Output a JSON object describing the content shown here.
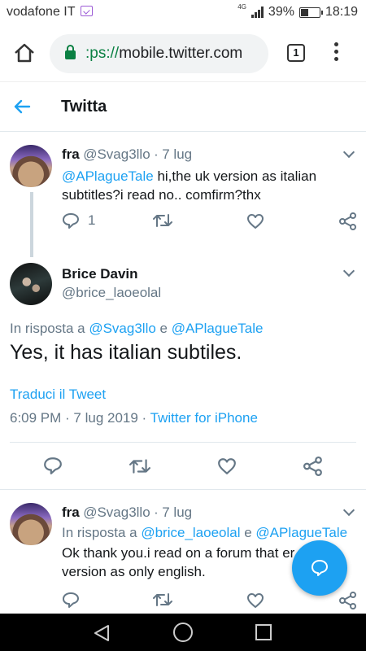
{
  "status_bar": {
    "carrier": "vodafone IT",
    "network": "4G",
    "battery": "39%",
    "battery_level": 0.39,
    "time": "18:19"
  },
  "browser": {
    "url_scheme": ":ps://",
    "url_host": "mobile.twitter.com",
    "tab_count": "1"
  },
  "header": {
    "title": "Twitta"
  },
  "tweets": [
    {
      "name": "fra",
      "handle": "@Svag3llo",
      "sep": "·",
      "date": "7 lug",
      "mention": "@APlagueTale",
      "text_line1": " hi,the uk version as italian",
      "text_line2": "subtitles?i read no.. comfirm?thx",
      "reply_count": "1"
    },
    {
      "name": "Brice Davin",
      "handle": "@brice_laoeolal",
      "reply_prefix": "In risposta a ",
      "reply_mention1": "@Svag3llo",
      "reply_and": " e ",
      "reply_mention2": "@APlagueTale",
      "text": "Yes, it has italian subtiles.",
      "translate": "Traduci il Tweet",
      "timestamp": "6:09 PM · 7 lug 2019 · ",
      "source": "Twitter for iPhone"
    },
    {
      "name": "fra",
      "handle": "@Svag3llo",
      "sep": "·",
      "date": "7 lug",
      "reply_prefix": "In risposta a ",
      "reply_mention1": "@brice_laoeolal",
      "reply_and": " e ",
      "reply_mention2": "@APlagueTale",
      "text_line1": "Ok thank you.i read on a forum that er",
      "text_line2": "version as only english."
    }
  ],
  "colors": {
    "twitter_blue": "#1da1f2",
    "muted_gray": "#657786",
    "secure_green": "#0b8043"
  },
  "icons": [
    "back-arrow-icon",
    "home-icon",
    "lock-icon",
    "reply-icon",
    "retweet-icon",
    "like-icon",
    "share-icon",
    "chevron-down-icon",
    "compose-icon"
  ]
}
